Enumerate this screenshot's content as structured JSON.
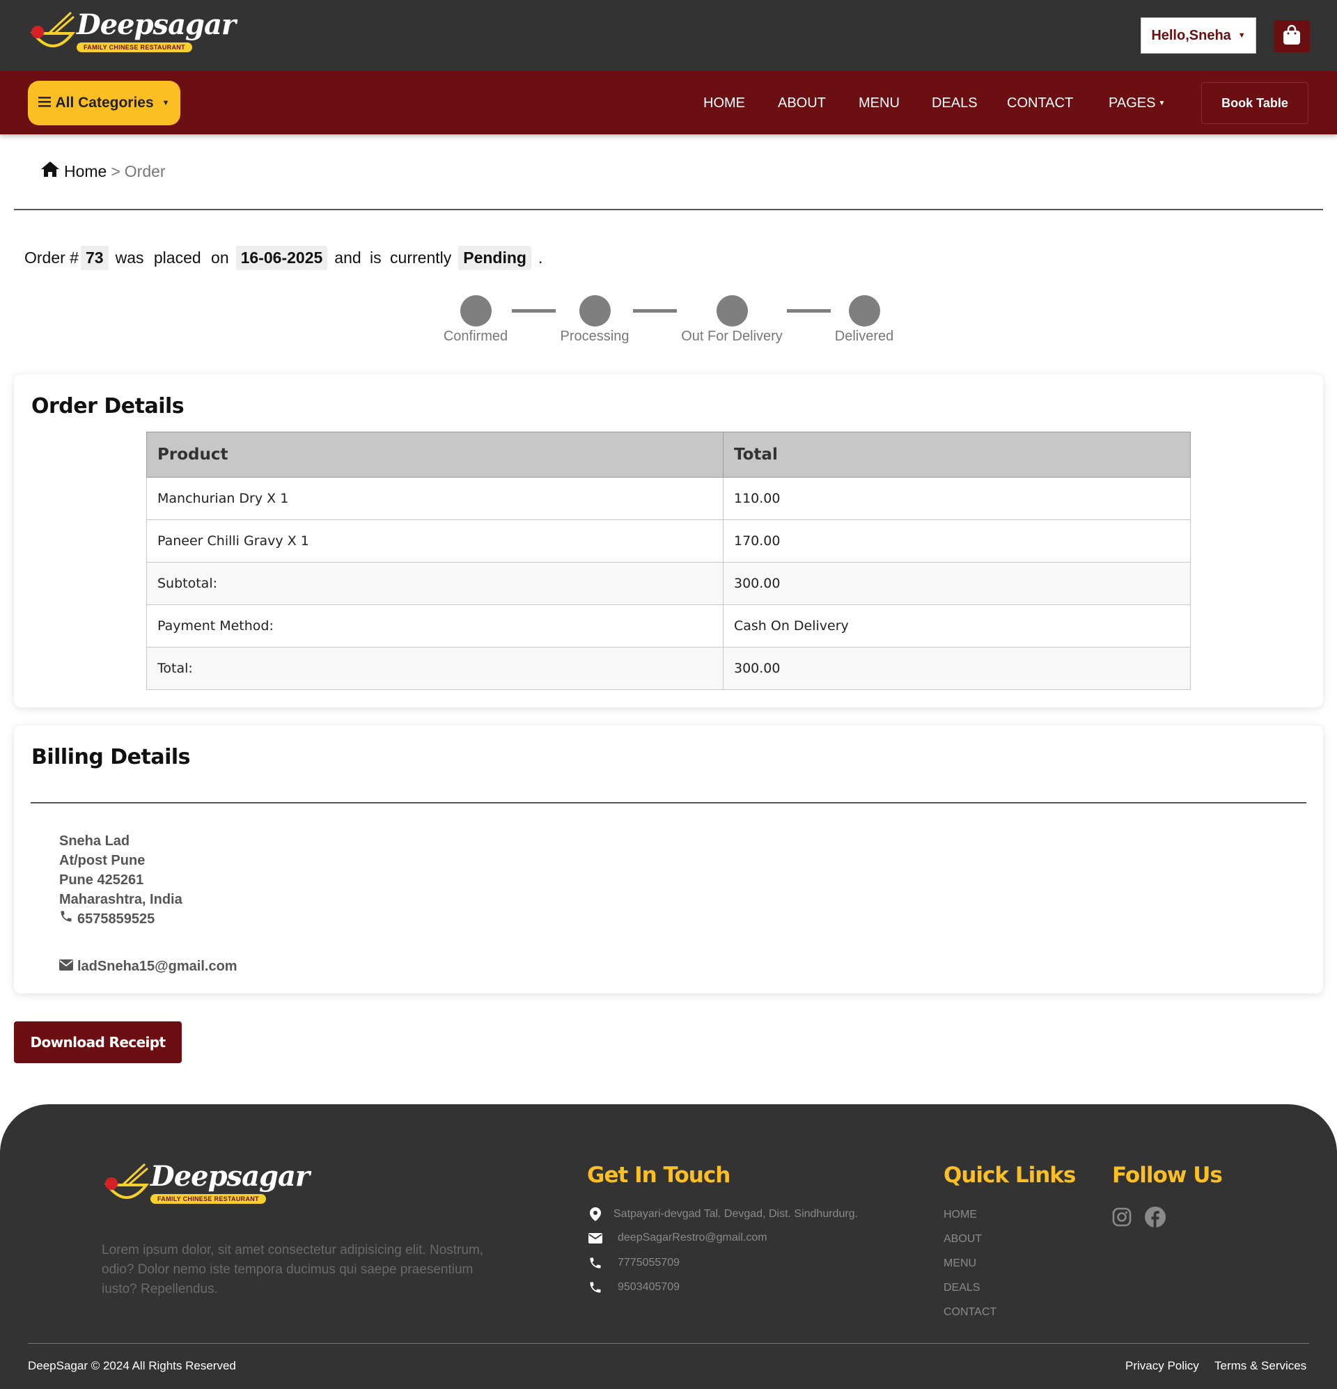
{
  "header": {
    "logo_text": "Deepsagar",
    "logo_tagline": "FAMILY CHINESE RESTAURANT",
    "user_greeting": "Hello,Sneha"
  },
  "nav": {
    "categories_label": "All Categories",
    "links": [
      "HOME",
      "ABOUT",
      "MENU",
      "DEALS",
      "CONTACT",
      "PAGES"
    ],
    "book_table_label": "Book Table"
  },
  "breadcrumb": {
    "home": "Home",
    "separator": ">",
    "current": "Order"
  },
  "order_status": {
    "prefix": "Order #",
    "order_number": "73",
    "placed_text": "was placed on",
    "date": "16-06-2025",
    "currently_text": "and is currently",
    "status": "Pending",
    "period": ".",
    "steps": [
      "Confirmed",
      "Processing",
      "Out For Delivery",
      "Delivered"
    ]
  },
  "order_details": {
    "title": "Order Details",
    "columns": [
      "Product",
      "Total"
    ],
    "rows": [
      [
        "Manchurian Dry X 1",
        "110.00"
      ],
      [
        "Paneer Chilli Gravy X 1",
        "170.00"
      ],
      [
        "Subtotal:",
        "300.00"
      ],
      [
        "Payment Method:",
        "Cash On Delivery"
      ],
      [
        "Total:",
        "300.00"
      ]
    ]
  },
  "billing": {
    "title": "Billing Details",
    "name": "Sneha Lad",
    "address1": "At/post Pune",
    "address2": "Pune 425261",
    "address3": "Maharashtra, India",
    "phone": "6575859525",
    "email": "ladSneha15@gmail.com"
  },
  "download_label": "Download Receipt",
  "footer": {
    "logo_text": "Deepsagar",
    "logo_tagline": "FAMILY CHINESE RESTAURANT",
    "about": "Lorem ipsum dolor, sit amet consectetur adipisicing elit. Nostrum, odio? Dolor nemo iste tempora ducimus qui saepe praesentium iusto? Repellendus.",
    "touch_title": "Get In Touch",
    "address": "Satpayari-devgad Tal. Devgad, Dist. Sindhurdurg.",
    "email": "deepSagarRestro@gmail.com",
    "phone1": "7775055709",
    "phone2": "9503405709",
    "quick_title": "Quick Links",
    "quick_links": [
      "HOME",
      "ABOUT",
      "MENU",
      "DEALS",
      "CONTACT"
    ],
    "follow_title": "Follow Us",
    "social_icons": [
      "instagram-icon",
      "facebook-icon"
    ],
    "copyright": "DeepSagar © 2024 All Rights Reserved",
    "privacy": "Privacy Policy",
    "terms": "Terms & Services"
  },
  "colors": {
    "maroon": "#6b0f12",
    "dark": "#333333",
    "yellow": "#fbbf24"
  }
}
